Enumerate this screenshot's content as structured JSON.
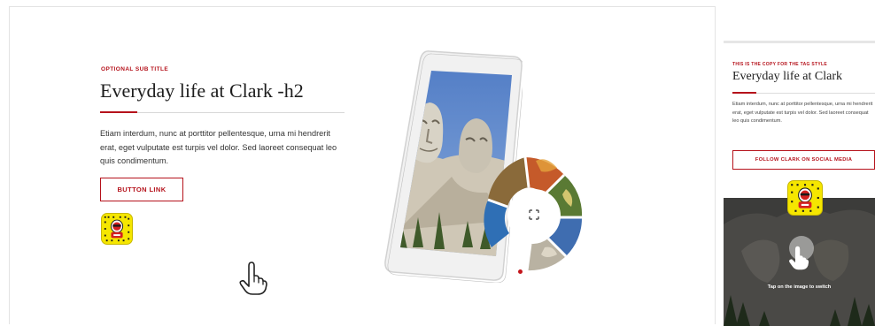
{
  "desktop": {
    "subtitle": "OPTIONAL SUB TITLE",
    "title": "Everyday life at Clark -h2",
    "body": "Etiam interdum, nunc at porttitor pellentesque, urna mi hendrerit erat, eget vulputate est turpis vel dolor. Sed laoreet consequat leo quis condimentum.",
    "button_label": "BUTTON LINK"
  },
  "mobile": {
    "tag": "THIS IS THE COPY FOR THE TAG STYLE",
    "title": "Everyday life at Clark",
    "body": "Etiam interdum, nunc at porttitor pellentesque, urna mi hendrerit erat, eget vulputate est turpis vel dolor. Sed laoreet consequat leo quis condimentum.",
    "button_label": "FOLLOW CLARK ON SOCIAL MEDIA",
    "caption": "Tap on the image to switch"
  },
  "colors": {
    "accent": "#b5121b",
    "snapchat_yellow": "#f5e600",
    "text": "#1d1d1d"
  },
  "icons": [
    "snapcode-icon",
    "tap-hand-icon",
    "expand-icon"
  ]
}
